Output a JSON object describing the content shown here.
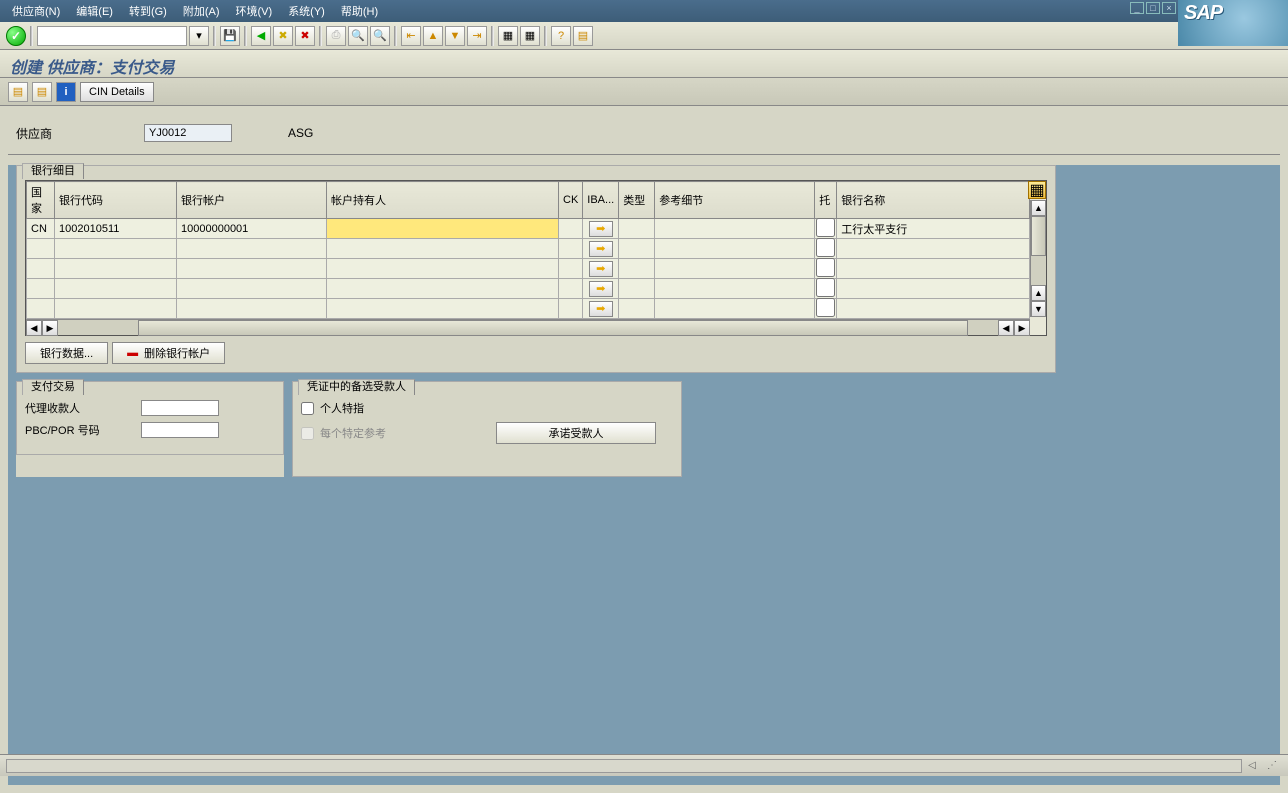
{
  "menu": {
    "vendor": "供应商(N)",
    "edit": "编辑(E)",
    "goto": "转到(G)",
    "extras": "附加(A)",
    "environment": "环境(V)",
    "system": "系统(Y)",
    "help": "帮助(H)"
  },
  "brand": "SAP",
  "title": "创建 供应商：支付交易",
  "app_toolbar": {
    "cin_details": "CIN Details"
  },
  "header": {
    "vendor_label": "供应商",
    "vendor_code": "YJ0012",
    "vendor_name": "ASG"
  },
  "bank_group": {
    "title": "银行细目",
    "columns": {
      "country": "国家",
      "bank_key": "银行代码",
      "bank_account": "银行帐户",
      "holder": "帐户持有人",
      "ck": "CK",
      "iba": "IBA...",
      "type": "类型",
      "reference": "参考细节",
      "mandate": "托",
      "bank_name": "银行名称"
    },
    "rows": [
      {
        "country": "CN",
        "bank_key": "1002010511",
        "bank_account": "10000000001",
        "holder": "",
        "ck": "",
        "type": "",
        "reference": "",
        "mandate": false,
        "bank_name": "工行太平支行"
      },
      {
        "country": "",
        "bank_key": "",
        "bank_account": "",
        "holder": "",
        "ck": "",
        "type": "",
        "reference": "",
        "mandate": false,
        "bank_name": ""
      },
      {
        "country": "",
        "bank_key": "",
        "bank_account": "",
        "holder": "",
        "ck": "",
        "type": "",
        "reference": "",
        "mandate": false,
        "bank_name": ""
      },
      {
        "country": "",
        "bank_key": "",
        "bank_account": "",
        "holder": "",
        "ck": "",
        "type": "",
        "reference": "",
        "mandate": false,
        "bank_name": ""
      },
      {
        "country": "",
        "bank_key": "",
        "bank_account": "",
        "holder": "",
        "ck": "",
        "type": "",
        "reference": "",
        "mandate": false,
        "bank_name": ""
      }
    ],
    "buttons": {
      "bank_data": "银行数据...",
      "delete_bank": "删除银行帐户"
    }
  },
  "payment_panel": {
    "title": "支付交易",
    "alt_payee_label": "代理收款人",
    "pbc_por_label": "PBC/POR 号码"
  },
  "payee_panel": {
    "title": "凭证中的备选受款人",
    "individual_label": "个人特指",
    "per_ref_label": "每个特定参考",
    "commit_label": "承诺受款人"
  }
}
